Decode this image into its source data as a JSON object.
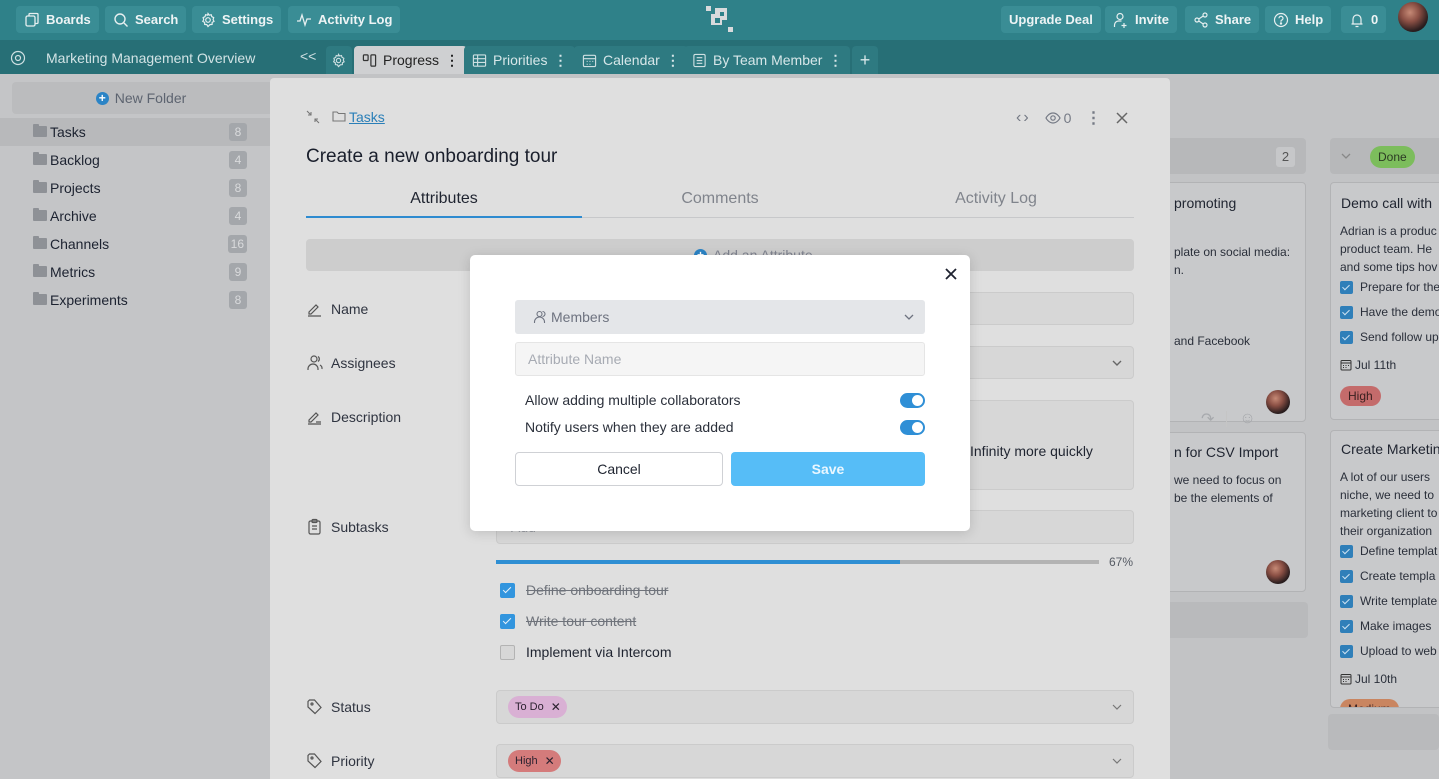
{
  "topbar": {
    "boards": "Boards",
    "search": "Search",
    "settings": "Settings",
    "activity_log": "Activity Log",
    "upgrade": "Upgrade Deal",
    "invite": "Invite",
    "share": "Share",
    "help": "Help",
    "notifications_count": "0"
  },
  "subbar": {
    "workspace_title": "Marketing Management Overview",
    "collapse": "<<",
    "tabs": [
      {
        "label": "Progress",
        "icon": "board-icon",
        "active": true
      },
      {
        "label": "Priorities",
        "icon": "table-icon",
        "active": false
      },
      {
        "label": "Calendar",
        "icon": "calendar-icon",
        "active": false
      },
      {
        "label": "By Team Member",
        "icon": "list-icon",
        "active": false
      }
    ],
    "add_tab": "+"
  },
  "sidebar": {
    "new_folder": "New Folder",
    "folders": [
      {
        "name": "Tasks",
        "count": "8",
        "active": true
      },
      {
        "name": "Backlog",
        "count": "4"
      },
      {
        "name": "Projects",
        "count": "8"
      },
      {
        "name": "Archive",
        "count": "4"
      },
      {
        "name": "Channels",
        "count": "16"
      },
      {
        "name": "Metrics",
        "count": "9"
      },
      {
        "name": "Experiments",
        "count": "8"
      }
    ]
  },
  "panel": {
    "breadcrumb": "Tasks",
    "title": "Create a new onboarding tour",
    "watchers": "0",
    "tabs": [
      "Attributes",
      "Comments",
      "Activity Log"
    ],
    "add_attribute": "Add an Attribute",
    "fields": {
      "name": "Name",
      "assignees": "Assignees",
      "description": "Description",
      "description_text": "Infinity more quickly",
      "subtasks": "Subtasks",
      "subtask_placeholder": "Add",
      "status": "Status",
      "priority": "Priority"
    },
    "progress": {
      "percent": 67,
      "label": "67%"
    },
    "subtasks": [
      {
        "text": "Define onboarding tour",
        "done": true
      },
      {
        "text": "Write tour content",
        "done": true
      },
      {
        "text": "Implement via Intercom",
        "done": false
      }
    ],
    "status_tag": {
      "label": "To Do",
      "color": "#d9b0d4"
    },
    "priority_tag": {
      "label": "High",
      "color": "#d47b7b"
    }
  },
  "modal": {
    "type_selected": "Members",
    "attribute_name_placeholder": "Attribute Name",
    "option_multiple": "Allow adding multiple collaborators",
    "option_multiple_on": true,
    "option_notify": "Notify users when they are added",
    "option_notify_on": true,
    "cancel": "Cancel",
    "save": "Save"
  },
  "board": {
    "column1": {
      "count": "2",
      "cards": [
        {
          "title": "promoting",
          "lines": [
            "plate on social media:",
            "n.",
            "",
            "",
            "and Facebook"
          ]
        },
        {
          "title": "n for CSV Import",
          "lines": [
            "we need to focus on",
            "be the elements of"
          ]
        }
      ]
    },
    "column2": {
      "status": "Done",
      "cards": [
        {
          "title": "Demo call with",
          "lines": [
            "Adrian is a produc",
            "product team. He",
            "and some tips hov"
          ],
          "checklist": [
            "Prepare for the",
            "Have the demo",
            "Send follow up"
          ],
          "date": "Jul 11th",
          "priority": "High"
        },
        {
          "title": "Create Marketin",
          "lines": [
            "A lot of our users",
            "niche, we need to",
            "marketing client to",
            "their organization"
          ],
          "checklist": [
            "Define templat",
            "Create templa",
            "Write template",
            "Make images",
            "Upload to web"
          ],
          "date": "Jul 10th",
          "priority": "Medium"
        }
      ]
    }
  },
  "colors": {
    "topbar": "#2f8189",
    "accent": "#2f8fd3",
    "save_button": "#56bdf7",
    "done": "#7cbd5c",
    "high": "#d47b7b",
    "medium": "#c98560"
  }
}
